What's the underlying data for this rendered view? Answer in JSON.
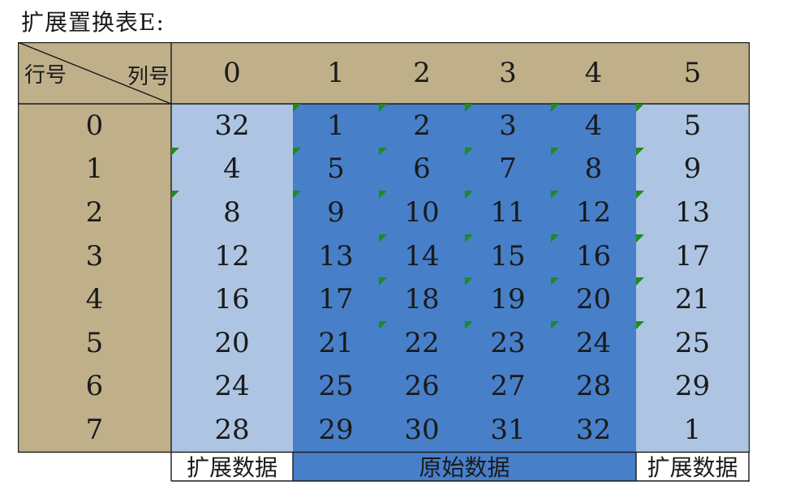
{
  "title": "扩展置换表E:",
  "corner": {
    "row_label": "行号",
    "col_label": "列号"
  },
  "columns": [
    "0",
    "1",
    "2",
    "3",
    "4",
    "5"
  ],
  "rows": [
    "0",
    "1",
    "2",
    "3",
    "4",
    "5",
    "6",
    "7"
  ],
  "table": [
    [
      "32",
      "1",
      "2",
      "3",
      "4",
      "5"
    ],
    [
      "4",
      "5",
      "6",
      "7",
      "8",
      "9"
    ],
    [
      "8",
      "9",
      "10",
      "11",
      "12",
      "13"
    ],
    [
      "12",
      "13",
      "14",
      "15",
      "16",
      "17"
    ],
    [
      "16",
      "17",
      "18",
      "19",
      "20",
      "21"
    ],
    [
      "20",
      "21",
      "22",
      "23",
      "24",
      "25"
    ],
    [
      "24",
      "25",
      "26",
      "27",
      "28",
      "29"
    ],
    [
      "28",
      "29",
      "30",
      "31",
      "32",
      "1"
    ]
  ],
  "footer": {
    "left": "扩展数据",
    "middle": "原始数据",
    "right": "扩展数据"
  },
  "colors": {
    "header": "#bfb08a",
    "expanded": "#adc5e2",
    "original": "#477fc9",
    "error_marker": "#1e8b1e"
  }
}
